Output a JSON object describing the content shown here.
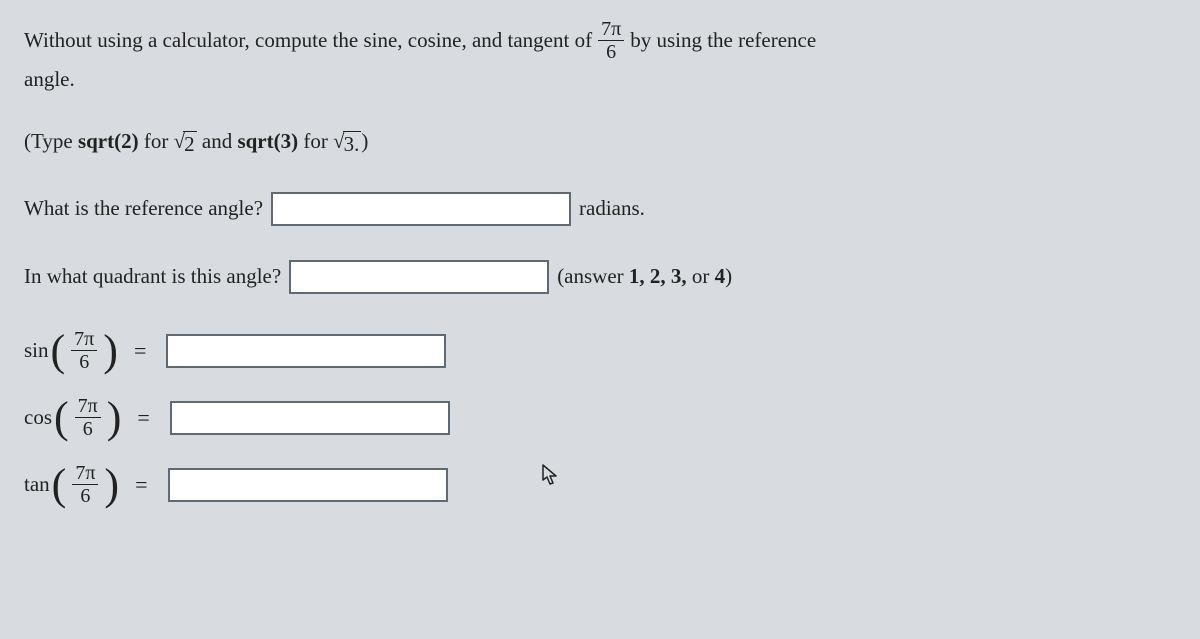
{
  "problem": {
    "intro_before": "Without using a calculator, compute the sine, cosine, and tangent of ",
    "intro_after": " by using the reference",
    "intro_line2": "angle.",
    "angle": {
      "num": "7π",
      "den": "6"
    }
  },
  "hint": {
    "before": "(Type ",
    "sqrt2_label": "sqrt(2)",
    "for1": " for ",
    "rad2": "2",
    "and": " and ",
    "sqrt3_label": "sqrt(3)",
    "for2": " for ",
    "rad3": "3.",
    "after": ")"
  },
  "questions": {
    "ref_label": "What is the reference angle?",
    "ref_unit": "radians.",
    "quad_label": "In what quadrant is this angle?",
    "quad_hint_prefix": "(answer ",
    "quad_hint_opts": "1, 2, 3,",
    "quad_hint_or": " or ",
    "quad_hint_last": "4",
    "quad_hint_suffix": ")"
  },
  "trig": {
    "sin": "sin",
    "cos": "cos",
    "tan": "tan",
    "eq": "=",
    "arg": {
      "num": "7π",
      "den": "6"
    }
  },
  "inputs": {
    "ref_value": "",
    "quad_value": "",
    "sin_value": "",
    "cos_value": "",
    "tan_value": ""
  }
}
